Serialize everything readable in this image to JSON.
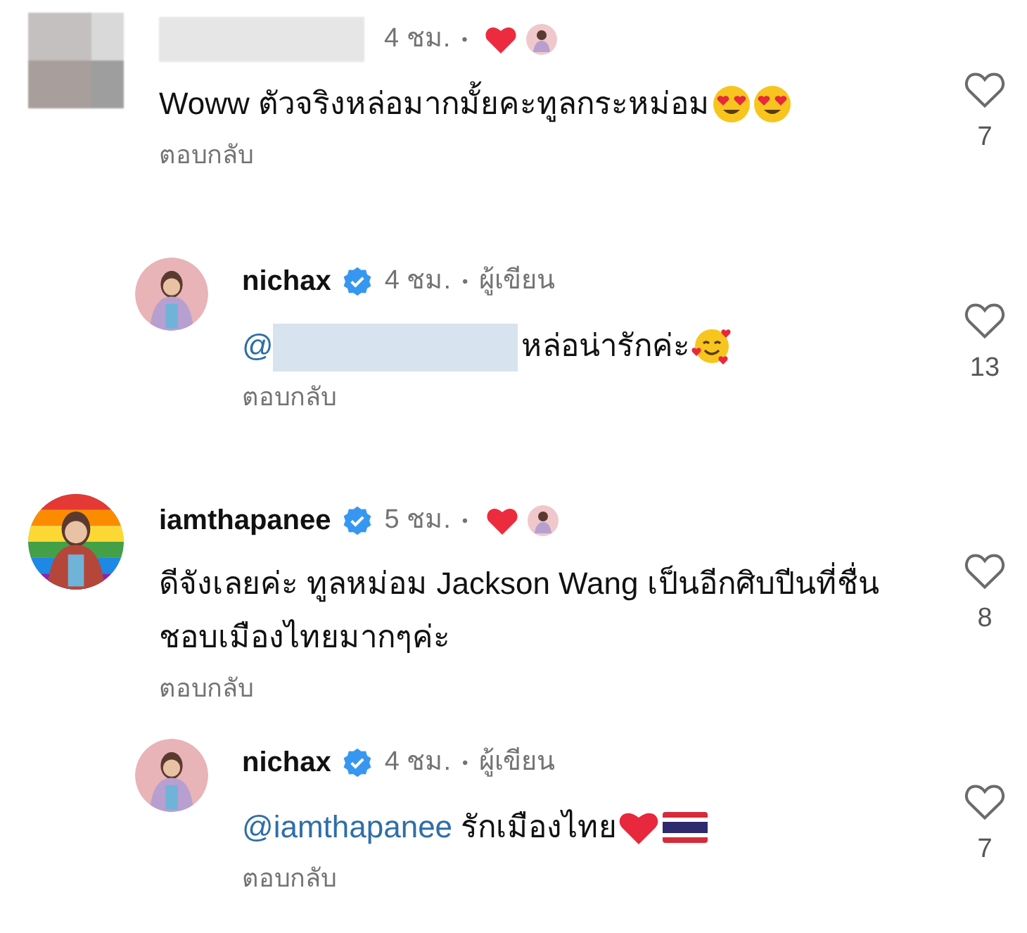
{
  "comments": [
    {
      "kind": "comment",
      "avatar": {
        "kind": "redacted"
      },
      "username_redacted": true,
      "time": "4 ชม.",
      "separator": "•",
      "liked_by_author": true,
      "text": "Woww ตัวจริงหล่อมากมั้ยคะทูลกระหม่อม",
      "emojis": [
        {
          "kind": "heart_eyes"
        },
        {
          "kind": "heart_eyes"
        }
      ],
      "reply_label": "ตอบกลับ",
      "like_count": "7"
    },
    {
      "kind": "reply",
      "avatar": {
        "kind": "picture"
      },
      "username": "nichax",
      "verified": true,
      "time": "4 ชม.",
      "separator": "•",
      "author_label": "ผู้เขียน",
      "mention": "@",
      "mention_redacted": true,
      "text": "หล่อน่ารักค่ะ",
      "emojis": [
        {
          "kind": "hearts_face"
        }
      ],
      "reply_label": "ตอบกลับ",
      "like_count": "13"
    },
    {
      "kind": "comment",
      "avatar": {
        "kind": "picture"
      },
      "username": "iamthapanee",
      "verified": true,
      "time": "5 ชม.",
      "separator": "•",
      "liked_by_author": true,
      "text": "ดีจังเลยค่ะ ทูลหม่อม Jackson Wang เป็นอีกศิบปีนที่ชื่นชอบเมืองไทยมากๆค่ะ",
      "reply_label": "ตอบกลับ",
      "like_count": "8"
    },
    {
      "kind": "reply",
      "avatar": {
        "kind": "picture"
      },
      "username": "nichax",
      "verified": true,
      "time": "4 ชม.",
      "separator": "•",
      "author_label": "ผู้เขียน",
      "mention": "@iamthapanee",
      "text": "รักเมืองไทย",
      "emojis": [
        {
          "kind": "red_heart"
        },
        {
          "kind": "thai_flag"
        }
      ],
      "reply_label": "ตอบกลับ",
      "like_count": "7"
    }
  ]
}
